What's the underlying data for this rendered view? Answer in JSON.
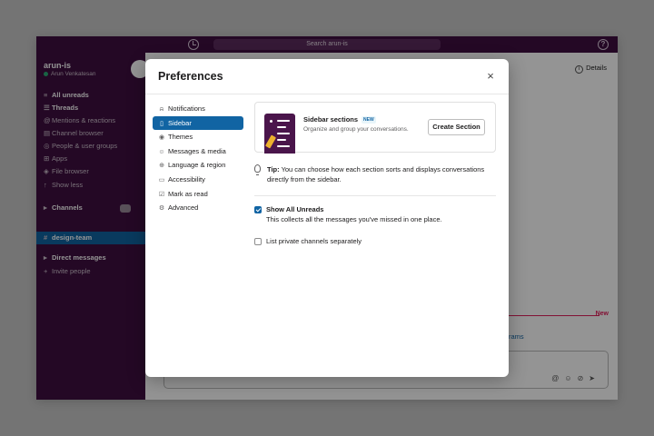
{
  "app": {
    "search_placeholder": "Search arun-is",
    "help_glyph": "?",
    "workspace": {
      "name": "arun-is",
      "user": "Arun Venkatesan"
    },
    "sidebar": {
      "items": [
        {
          "label": "All unreads",
          "icon": "list-icon"
        },
        {
          "label": "Threads",
          "icon": "threads-icon"
        },
        {
          "label": "Mentions & reactions",
          "icon": "at-icon"
        },
        {
          "label": "Channel browser",
          "icon": "channel-browser-icon"
        },
        {
          "label": "People & user groups",
          "icon": "people-icon"
        },
        {
          "label": "Apps",
          "icon": "apps-icon"
        },
        {
          "label": "File browser",
          "icon": "file-icon"
        },
        {
          "label": "Show less",
          "icon": "chevron-up-icon"
        }
      ],
      "channels_header": "Channels",
      "active_channel": "design-team",
      "dm_header": "Direct messages",
      "invite": "Invite people"
    },
    "main": {
      "details_label": "Details",
      "new_label": "New",
      "partial_text": "rams"
    }
  },
  "modal": {
    "title": "Preferences",
    "close_glyph": "×",
    "nav": [
      {
        "label": "Notifications",
        "icon": "bell-icon",
        "glyph": "♫"
      },
      {
        "label": "Sidebar",
        "icon": "sidebar-icon",
        "glyph": "▯",
        "active": true
      },
      {
        "label": "Themes",
        "icon": "eye-icon",
        "glyph": "◉"
      },
      {
        "label": "Messages & media",
        "icon": "message-icon",
        "glyph": "☺"
      },
      {
        "label": "Language & region",
        "icon": "globe-icon",
        "glyph": "⊕"
      },
      {
        "label": "Accessibility",
        "icon": "monitor-icon",
        "glyph": "▭"
      },
      {
        "label": "Mark as read",
        "icon": "check-square-icon",
        "glyph": "☑"
      },
      {
        "label": "Advanced",
        "icon": "gear-icon",
        "glyph": "⚙"
      }
    ],
    "card": {
      "title": "Sidebar sections",
      "badge": "NEW",
      "subtitle": "Organize and group your conversations.",
      "button": "Create Section"
    },
    "tip": {
      "label": "Tip:",
      "text": "You can choose how each section sorts and displays conversations directly from the sidebar."
    },
    "options": [
      {
        "label": "Show All Unreads",
        "desc": "This collects all the messages you've missed in one place.",
        "checked": true
      },
      {
        "label": "List private channels separately",
        "checked": false
      }
    ]
  },
  "colors": {
    "accent": "#1164a3",
    "aubergine": "#3f0e40",
    "new_red": "#e01e5a"
  }
}
